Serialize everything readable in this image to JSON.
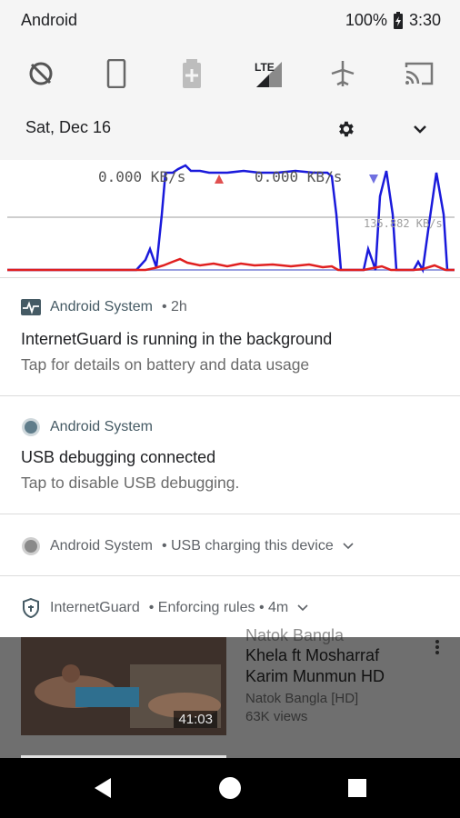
{
  "status_bar": {
    "carrier": "Android",
    "battery": "100%",
    "time": "3:30"
  },
  "quick_settings": [
    {
      "icon": "data-saver-icon"
    },
    {
      "icon": "phone-rotate-icon"
    },
    {
      "icon": "battery-saver-icon"
    },
    {
      "icon": "lte-signal-icon",
      "label": "LTE"
    },
    {
      "icon": "airplane-mode-icon"
    },
    {
      "icon": "cast-icon"
    }
  ],
  "date_row": {
    "date": "Sat, Dec 16"
  },
  "graph": {
    "upload_rate": "0.000 KB/s",
    "download_rate": "0.000 KB/s",
    "max_label": "135.882 KB/s",
    "colors": {
      "download": "#1a1adb",
      "upload": "#e02020",
      "baseline": "#9aa0e0"
    }
  },
  "notifications": [
    {
      "app": "Android System",
      "meta": "• 2h",
      "title": "InternetGuard is running in the background",
      "text": "Tap for details on battery and data usage"
    },
    {
      "app": "Android System",
      "title": "USB debugging connected",
      "text": "Tap to disable USB debugging."
    },
    {
      "app": "Android System",
      "meta": "• USB charging this device"
    },
    {
      "app": "InternetGuard",
      "meta": "• Enforcing rules • 4m"
    }
  ],
  "background_video": {
    "title_partial": "Natok Bangla",
    "title_line2": "Khela ft Mosharraf",
    "title_line3": "Karim   Munmun HD",
    "channel": "Natok Bangla [HD]",
    "views": "63K views",
    "duration": "41:03"
  }
}
